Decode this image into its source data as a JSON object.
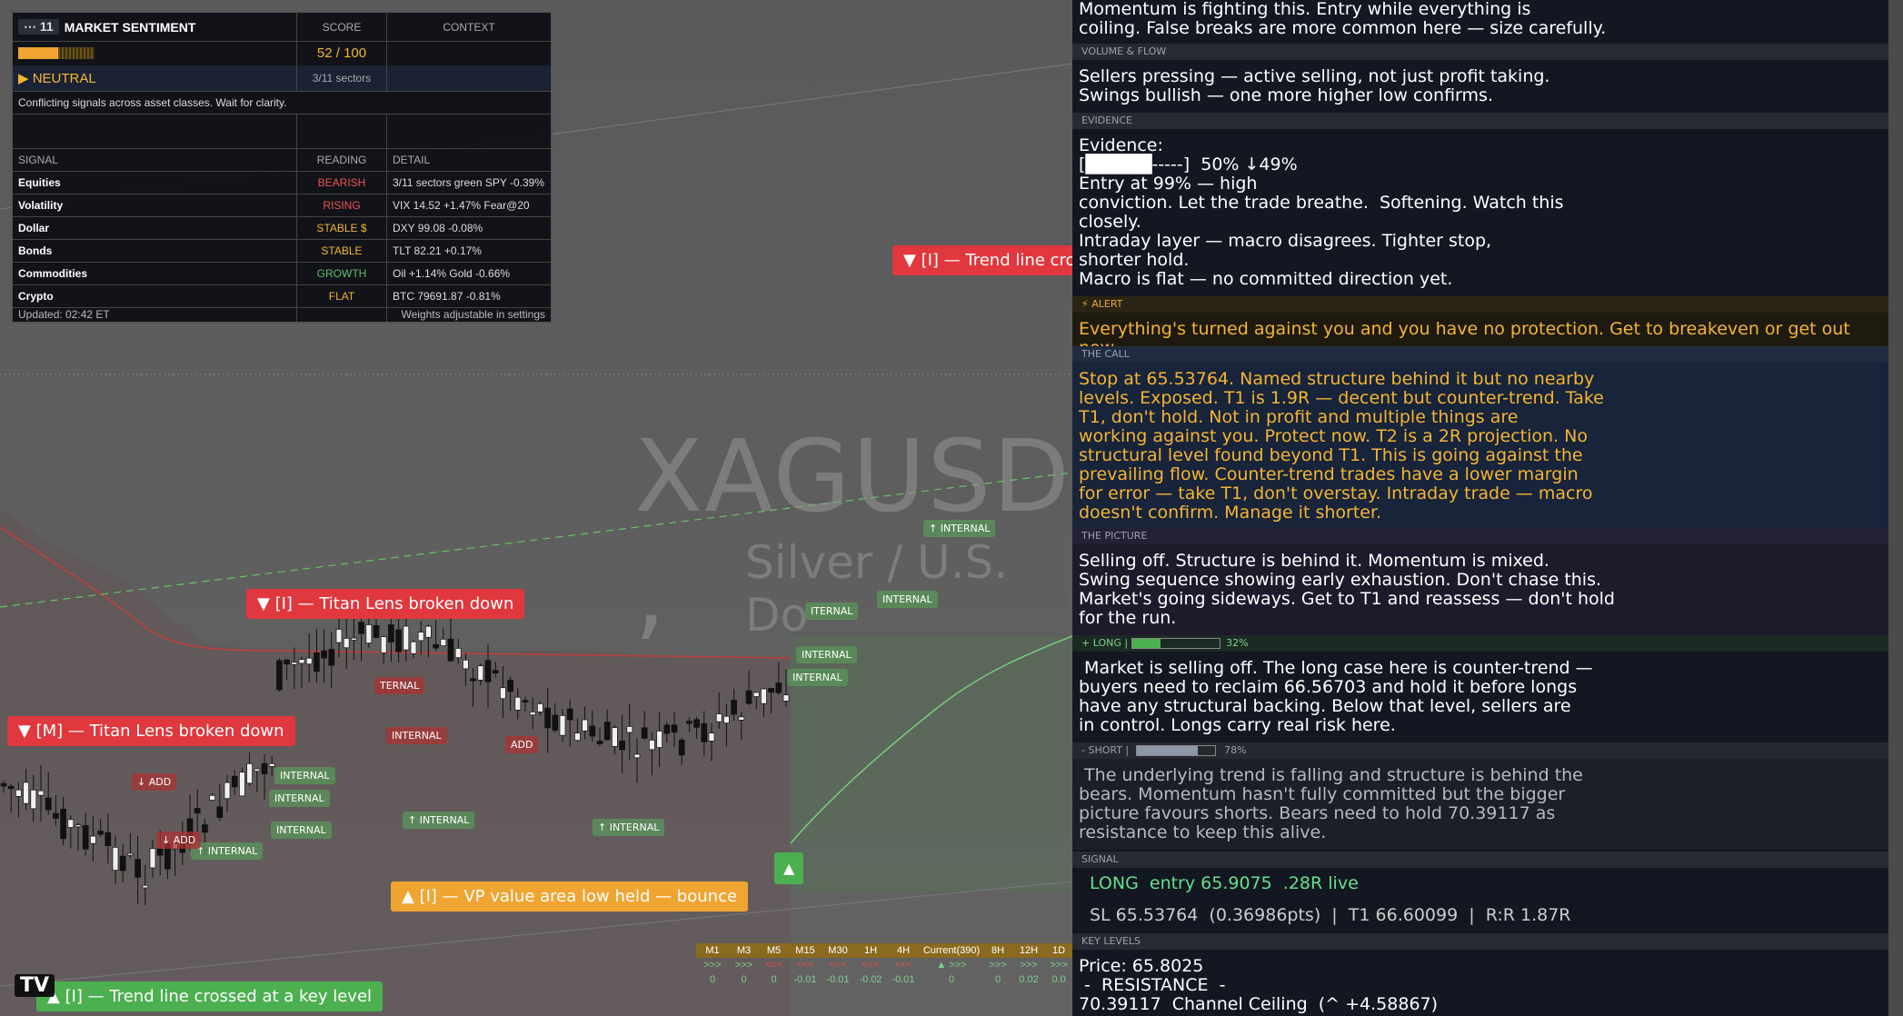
{
  "chart": {
    "symbol": "XAGUSD ,",
    "subtitle": "Silver / U.S. Do",
    "labels": {
      "trend_top": "▼ [I] — Trend line cros",
      "titan_i": "▼ [I] — Titan Lens broken down",
      "titan_m": "▼ [M] — Titan Lens broken down",
      "vp": "▲ [I] — VP value area low held — bounce",
      "trend_bottom": "▲ [I] — Trend line crossed at a key level"
    },
    "marks": {
      "internal": "INTERNAL",
      "up_internal": "↑ INTERNAL",
      "add": "ADD",
      "down_add": "↓ ADD",
      "ternal": "TERNAL",
      "iternal": "ITERNAL",
      "triangle": "▲"
    },
    "tf": {
      "headers": [
        "M1",
        "M3",
        "M5",
        "M15",
        "M30",
        "1H",
        "4H",
        "Current(390)",
        "8H",
        "12H",
        "1D"
      ],
      "row1": [
        ">>>",
        ">>>",
        "<<<",
        "<<<",
        "<<<",
        "<<<",
        "<<<",
        "▲ >>>",
        ">>>",
        ">>>",
        ">>>"
      ],
      "row2": [
        "0",
        "0",
        "0",
        "-0.01",
        "-0.01",
        "-0.02",
        "-0.01",
        "0",
        "0",
        "0.02",
        "0.0"
      ]
    },
    "logo": "TV",
    "colors": {
      "red_label": "#e0383e",
      "orange_label": "#f0a532",
      "green_label": "#4caf50"
    }
  },
  "sentiment": {
    "title": "MARKET SENTIMENT",
    "badge": "11",
    "col_score": "SCORE",
    "col_context": "CONTEXT",
    "score": "52 / 100",
    "score_fraction": 0.52,
    "state": "▶ NEUTRAL",
    "sectors": "3/11 sectors",
    "message": "Conflicting signals across asset classes. Wait for clarity.",
    "col_signal": "SIGNAL",
    "col_reading": "READING",
    "col_detail": "DETAIL",
    "rows": [
      {
        "signal": "Equities",
        "reading": "BEARISH",
        "detail": "3/11 sectors green  SPY -0.39%",
        "color": "#ef5350"
      },
      {
        "signal": "Volatility",
        "reading": "RISING",
        "detail": "VIX 14.52  +1.47%  Fear@20",
        "color": "#ef5350"
      },
      {
        "signal": "Dollar",
        "reading": "STABLE $",
        "detail": "DXY 99.08  -0.08%",
        "color": "#f5b433"
      },
      {
        "signal": "Bonds",
        "reading": "STABLE",
        "detail": "TLT 82.21  +0.17%",
        "color": "#f5b433"
      },
      {
        "signal": "Commodities",
        "reading": "GROWTH",
        "detail": "Oil +1.14%  Gold -0.66%",
        "color": "#66bb6a"
      },
      {
        "signal": "Crypto",
        "reading": "FLAT",
        "detail": "BTC 79691.87  -0.81%",
        "color": "#f5b433"
      }
    ],
    "updated": "Updated: 02:42 ET",
    "weights": "Weights adjustable in settings"
  },
  "panel": {
    "momentum": "Momentum is fighting this. Entry while everything is\ncoiling. False breaks are more common here — size carefully.",
    "volume_label": "VOLUME & FLOW",
    "volume": "Sellers pressing — active selling, not just profit taking.\nSwings bullish — one more higher low confirms.",
    "evidence_label": "EVIDENCE",
    "evidence_title": "Evidence:",
    "evidence_bar": "[█████-----]  50% ↓49%",
    "evidence_body": "Entry at 99% — high\nconviction. Let the trade breathe.  Softening. Watch this\nclosely.\nIntraday layer — macro disagrees. Tighter stop,\nshorter hold.\nMacro is flat — no committed direction yet.",
    "alert_label": "⚡ ALERT",
    "alert": "Everything's turned against you and you have no protection. Get to breakeven or get out now.",
    "call_label": "THE CALL",
    "call": "Stop at 65.53764. Named structure behind it but no nearby\nlevels. Exposed. T1 is 1.9R — decent but counter-trend. Take\nT1, don't hold. Not in profit and multiple things are\nworking against you. Protect now. T2 is a 2R projection. No\nstructural level found beyond T1. This is going against the\nprevailing flow. Counter-trend trades have a lower margin\nfor error — take T1, don't overstay. Intraday trade — macro\ndoesn't confirm. Manage it shorter.",
    "picture_label": "THE PICTURE",
    "picture": "Selling off. Structure is behind it. Momentum is mixed.\nSwing sequence showing early exhaustion. Don't chase this.\nMarket's going sideways. Get to T1 and reassess — don't hold\nfor the run.",
    "long_label": "+ LONG  |",
    "long_pct": "32%",
    "long_fraction": 0.32,
    "long": " Market is selling off. The long case here is counter-trend —\nbuyers need to reclaim 66.56703 and hold it before longs\nhave any structural backing. Below that level, sellers are\nin control. Longs carry real risk here.",
    "short_label": "- SHORT  |",
    "short_pct": "78%",
    "short_fraction": 0.78,
    "short": " The underlying trend is falling and structure is behind the\nbears. Momentum hasn't fully committed but the bigger\npicture favours shorts. Bears need to hold 70.39117 as\nresistance to keep this alive.",
    "signal_label": "SIGNAL",
    "signal_line1": "LONG  entry 65.9075  .28R live",
    "signal_line2": "SL 65.53764  (0.36986pts)  |  T1 66.60099  |  R:R 1.87R",
    "levels_label": "KEY LEVELS",
    "levels": "Price: 65.8025\n -  RESISTANCE  -\n70.39117  Channel Ceiling  (^ +4.58867)"
  }
}
